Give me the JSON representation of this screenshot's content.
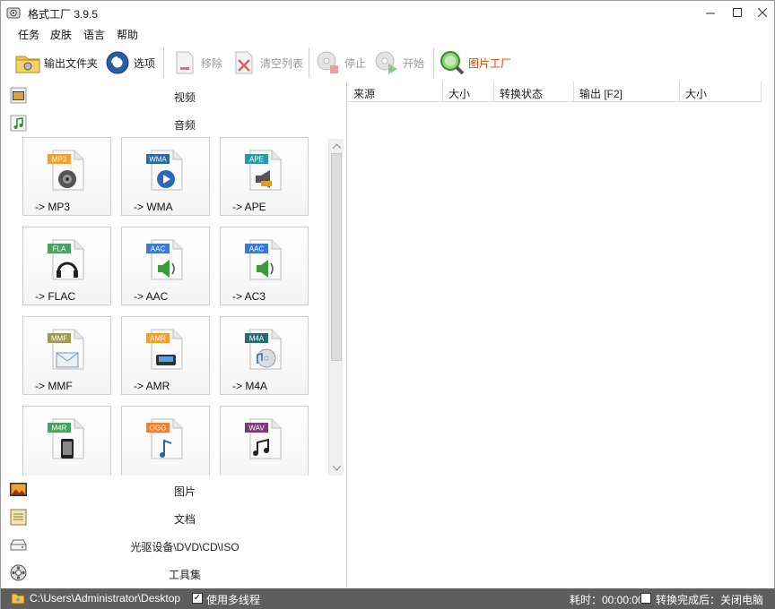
{
  "window": {
    "title": "格式工厂 3.9.5",
    "controls": [
      "minimize",
      "maximize",
      "close"
    ]
  },
  "menu": [
    "任务",
    "皮肤",
    "语言",
    "帮助"
  ],
  "toolbar": {
    "output_folder": "输出文件夹",
    "options": "选项",
    "remove": "移除",
    "clear_list": "清空列表",
    "stop": "停止",
    "start": "开始",
    "picture_factory": "图片工厂"
  },
  "categories_top": [
    {
      "name": "video",
      "label": "视频",
      "icon": "film-icon"
    },
    {
      "name": "audio",
      "label": "音频",
      "icon": "music-note-icon"
    }
  ],
  "audio_formats": [
    {
      "badge": "MP3",
      "badge_color": "#f0a030",
      "label": "-> MP3",
      "icon": "speaker-icon"
    },
    {
      "badge": "WMA",
      "badge_color": "#2a6aa0",
      "label": "-> WMA",
      "icon": "play-disc-icon"
    },
    {
      "badge": "APE",
      "badge_color": "#2a9aa8",
      "label": "-> APE",
      "icon": "horn-icon"
    },
    {
      "badge": "FLA",
      "badge_color": "#4aa060",
      "label": "-> FLAC",
      "icon": "headphones-icon"
    },
    {
      "badge": "AAC",
      "badge_color": "#3a7ad0",
      "label": "-> AAC",
      "icon": "speaker-wave-icon"
    },
    {
      "badge": "AAC",
      "badge_color": "#3a7ad0",
      "label": "-> AC3",
      "icon": "speaker-wave-icon"
    },
    {
      "badge": "MMF",
      "badge_color": "#9a9a50",
      "label": "-> MMF",
      "icon": "envelope-icon"
    },
    {
      "badge": "AMR",
      "badge_color": "#f0a030",
      "label": "-> AMR",
      "icon": "phone-icon"
    },
    {
      "badge": "M4A",
      "badge_color": "#2a6a70",
      "label": "-> M4A",
      "icon": "cd-music-icon"
    },
    {
      "badge": "M4R",
      "badge_color": "#4aa060",
      "label": "",
      "icon": "iphone-icon"
    },
    {
      "badge": "OGG",
      "badge_color": "#f08030",
      "label": "",
      "icon": "note-icon"
    },
    {
      "badge": "WAV",
      "badge_color": "#7a3a7a",
      "label": "",
      "icon": "notes-icon"
    }
  ],
  "categories_bottom": [
    {
      "name": "picture",
      "label": "图片",
      "icon": "picture-icon"
    },
    {
      "name": "document",
      "label": "文档",
      "icon": "document-icon"
    },
    {
      "name": "optical",
      "label": "光驱设备\\DVD\\CD\\ISO",
      "icon": "drive-icon"
    },
    {
      "name": "tools",
      "label": "工具集",
      "icon": "tools-icon"
    }
  ],
  "task_columns": [
    "来源",
    "大小",
    "转换状态",
    "输出 [F2]",
    "大小"
  ],
  "status": {
    "path": "C:\\Users\\Administrator\\Desktop",
    "multithread_label": "使用多线程",
    "multithread_checked": true,
    "elapsed": "耗时：00:00:00",
    "after_convert_label": "转换完成后：关闭电脑",
    "after_convert_checked": false
  }
}
